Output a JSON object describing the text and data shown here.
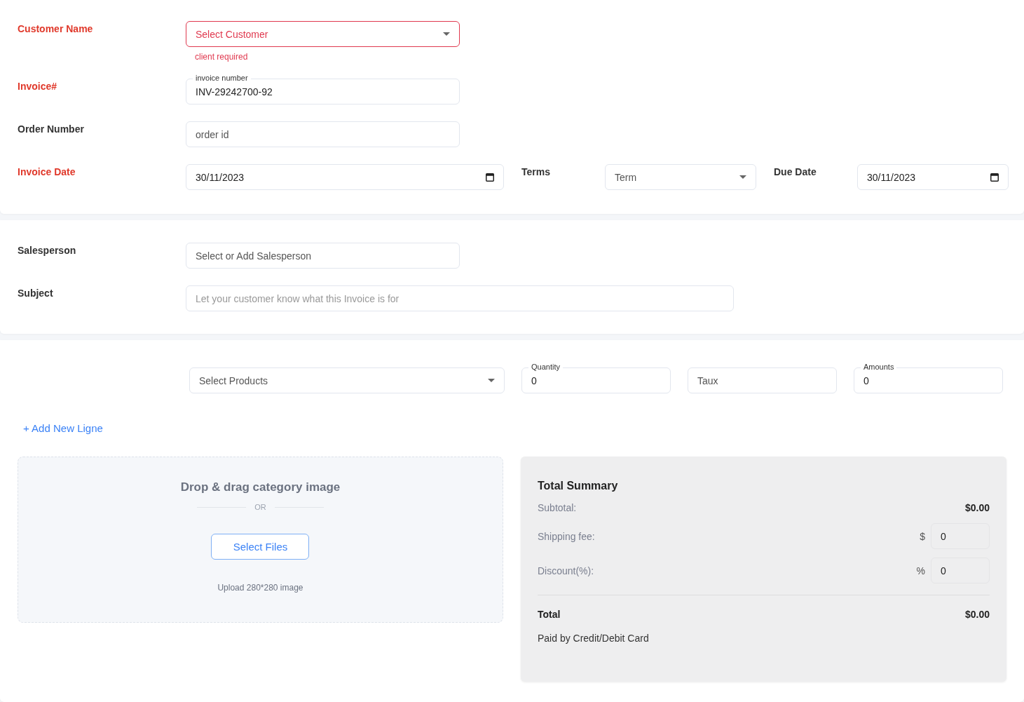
{
  "invoice_details": {
    "fields": [
      {
        "kind": "select",
        "label": "Customer Name",
        "required": true,
        "placeholder": "Select Customer",
        "error": "client required"
      },
      {
        "kind": "text",
        "label": "Invoice#",
        "required": true,
        "floating_label": "invoice number",
        "value": "INV-29242700-92"
      },
      {
        "kind": "text",
        "label": "Order Number",
        "required": false,
        "placeholder": "order id"
      },
      {
        "kind": "date",
        "label": "Invoice Date",
        "required": true,
        "value": "30/11/2023"
      }
    ],
    "terms": {
      "label": "Terms",
      "placeholder": "Term"
    },
    "due_date": {
      "label": "Due Date",
      "value": "30/11/2023"
    }
  },
  "sales": {
    "salesperson": {
      "label": "Salesperson",
      "placeholder": "Select or Add Salesperson"
    },
    "subject": {
      "label": "Subject",
      "placeholder": "Let your customer know what this Invoice is for"
    }
  },
  "line_item": {
    "product": {
      "placeholder": "Select Products"
    },
    "quantity": {
      "floating_label": "Quantity",
      "value": "0"
    },
    "rate": {
      "placeholder": "Taux"
    },
    "amount": {
      "floating_label": "Amounts",
      "value": "0"
    }
  },
  "add_line_link": "+ Add New Ligne",
  "upload": {
    "title": "Drop & drag category image",
    "separator": "OR",
    "button": "Select Files",
    "hint": "Upload 280*280 image"
  },
  "summary": {
    "title": "Total Summary",
    "subtotal": {
      "label": "Subtotal:",
      "value": "$0.00"
    },
    "shipping": {
      "label": "Shipping fee:",
      "symbol": "$",
      "value": "0"
    },
    "discount": {
      "label": "Discount(%):",
      "symbol": "%",
      "value": "0"
    },
    "total": {
      "label": "Total",
      "value": "$0.00"
    },
    "payment_note": "Paid by Credit/Debit Card"
  }
}
